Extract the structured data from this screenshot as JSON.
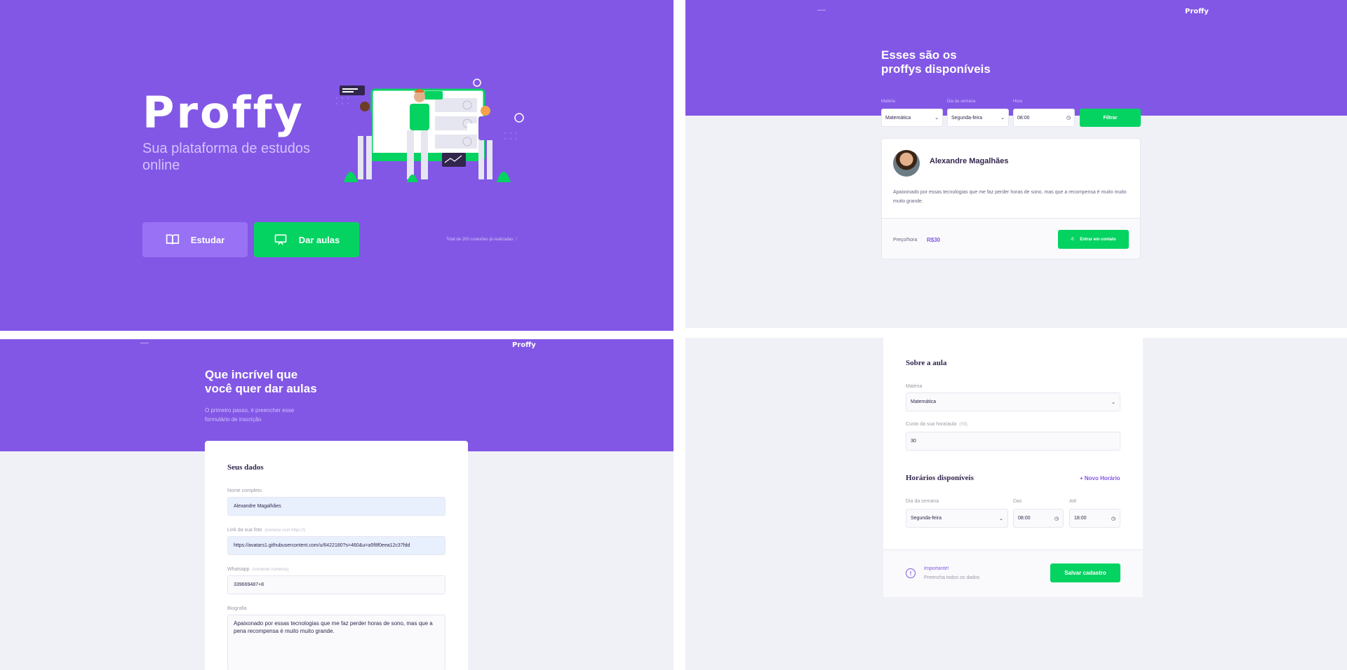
{
  "landing": {
    "logo": "Proffy",
    "tagline": "Sua plataforma de estudos online",
    "study_button": "Estudar",
    "teach_button": "Dar aulas",
    "connections_text": "Total de 200 conexões já realizadas"
  },
  "list_page": {
    "logo": "Proffy",
    "title_line1": "Esses são os",
    "title_line2": "proffys disponíveis",
    "filters": {
      "subject_label": "Matéria",
      "subject_value": "Matemática",
      "weekday_label": "Dia da semana",
      "weekday_value": "Segunda-feira",
      "time_label": "Hora",
      "time_value": "08:00",
      "submit_label": "Filtrar"
    },
    "teacher": {
      "name": "Alexandre Magalhães",
      "bio": "Apaixonado por essas tecnologias que me faz perder horas de sono, mas que a recompensa é muito muito muito grande.",
      "price_label": "Preço/hora",
      "price_value": "R$30",
      "contact_label": "Entrar em contato"
    }
  },
  "form_page": {
    "logo": "Proffy",
    "title_line1": "Que incrível que",
    "title_line2": "você quer dar aulas",
    "subtitle": "O primeiro passo, é preencher esse formulário de inscrição",
    "section_title": "Seus dados",
    "name_label": "Nome completo",
    "name_value": "Alexandre Magalhães",
    "avatar_label": "Link da sua foto",
    "avatar_hint": "(comece com https://)",
    "avatar_value": "https://avatars1.githubusercontent.com/u/6422180?s=460&u=a5f8f0eea12c37fdd",
    "whatsapp_label": "Whatsapp",
    "whatsapp_hint": "(somente números)",
    "whatsapp_value": "339669487+8",
    "bio_label": "Biografia",
    "bio_value": "Apaixonado por essas tecnologias que me faz perder horas de sono, mas que a pena recompensa é muito muito grande."
  },
  "form_page_2": {
    "about_title": "Sobre a aula",
    "subject_label": "Matéria",
    "subject_value": "Matemática",
    "cost_label": "Custo da sua hora/aula",
    "cost_hint": "(R$)",
    "cost_value": "30",
    "schedule_title": "Horários disponíveis",
    "new_schedule": "+ Novo Horário",
    "weekday_label": "Dia da semana",
    "weekday_value": "Segunda-feira",
    "from_label": "Das",
    "from_value": "08:00",
    "to_label": "Até",
    "to_value": "18:00",
    "warning_title": "Importante!",
    "warning_text": "Preencha todos os dados",
    "save_label": "Salvar cadastro"
  },
  "colors": {
    "primary": "#8257e5",
    "primary_light": "#9871f5",
    "secondary": "#04d361",
    "background": "#f0f0f7",
    "text_title": "#32264d"
  }
}
